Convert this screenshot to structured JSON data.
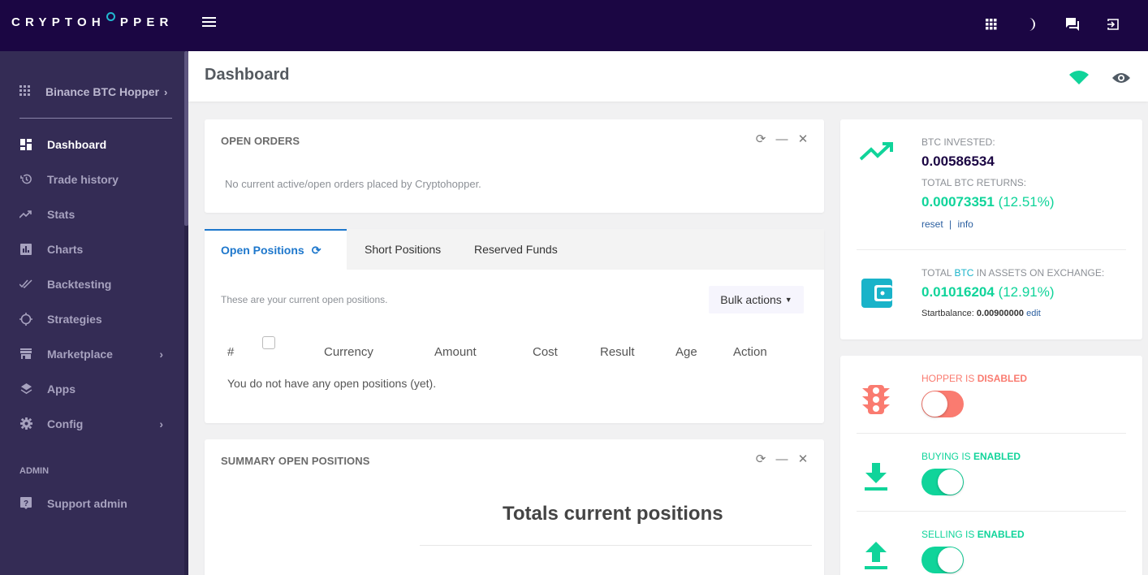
{
  "topbar": {
    "logo_pre": "CRYPTOH",
    "logo_post": "PPER",
    "icons": [
      "apps-grid-icon",
      "moon-icon",
      "chat-icon",
      "logout-icon"
    ]
  },
  "sidebar": {
    "hopper_name": "Binance BTC Hopper",
    "items": [
      {
        "label": "Dashboard",
        "icon": "dashboard-icon",
        "active": true
      },
      {
        "label": "Trade history",
        "icon": "history-icon"
      },
      {
        "label": "Stats",
        "icon": "trending-icon"
      },
      {
        "label": "Charts",
        "icon": "bar-chart-icon"
      },
      {
        "label": "Backtesting",
        "icon": "double-check-icon"
      },
      {
        "label": "Strategies",
        "icon": "crosshair-icon"
      },
      {
        "label": "Marketplace",
        "icon": "store-icon",
        "has_submenu": true
      },
      {
        "label": "Apps",
        "icon": "layers-icon"
      },
      {
        "label": "Config",
        "icon": "gear-icon",
        "has_submenu": true
      }
    ],
    "admin_section": "ADMIN",
    "admin_items": [
      {
        "label": "Support admin",
        "icon": "help-icon"
      }
    ]
  },
  "page": {
    "title": "Dashboard"
  },
  "open_orders": {
    "title": "OPEN ORDERS",
    "empty_text": "No current active/open orders placed by Cryptohopper."
  },
  "positions": {
    "tabs": [
      {
        "label": "Open Positions",
        "active": true
      },
      {
        "label": "Short Positions"
      },
      {
        "label": "Reserved Funds"
      }
    ],
    "description": "These are your current open positions.",
    "bulk_actions": "Bulk actions",
    "columns": [
      "#",
      "Currency",
      "Amount",
      "Cost",
      "Result",
      "Age",
      "Action"
    ],
    "empty_text": "You do not have any open positions (yet)."
  },
  "summary": {
    "title": "SUMMARY OPEN POSITIONS",
    "heading": "Totals current positions"
  },
  "stats": {
    "invested_label": "BTC INVESTED:",
    "invested_value": "0.00586534",
    "returns_label": "TOTAL BTC RETURNS:",
    "returns_value": "0.00073351",
    "returns_pct": "(12.51%)",
    "reset": "reset",
    "sep": "|",
    "info": "info",
    "assets_label_pre": "TOTAL ",
    "assets_label_coin": "BTC",
    "assets_label_post": " IN ASSETS ON EXCHANGE:",
    "assets_value": "0.01016204",
    "assets_pct": "(12.91%)",
    "startbalance_label": "Startbalance:",
    "startbalance_value": "0.00900000",
    "edit": "edit"
  },
  "controls": {
    "hopper": {
      "prefix": "HOPPER IS ",
      "state": "DISABLED",
      "enabled": false
    },
    "buying": {
      "prefix": "BUYING IS ",
      "state": "ENABLED",
      "enabled": true
    },
    "selling": {
      "prefix": "SELLING IS ",
      "state": "ENABLED",
      "enabled": true
    }
  },
  "colors": {
    "topbar": "#1b0643",
    "sidebar": "#342c55",
    "accent_blue": "#1d77cc",
    "green": "#10d49a",
    "red": "#fa7b70",
    "teal": "#19b3c9"
  }
}
